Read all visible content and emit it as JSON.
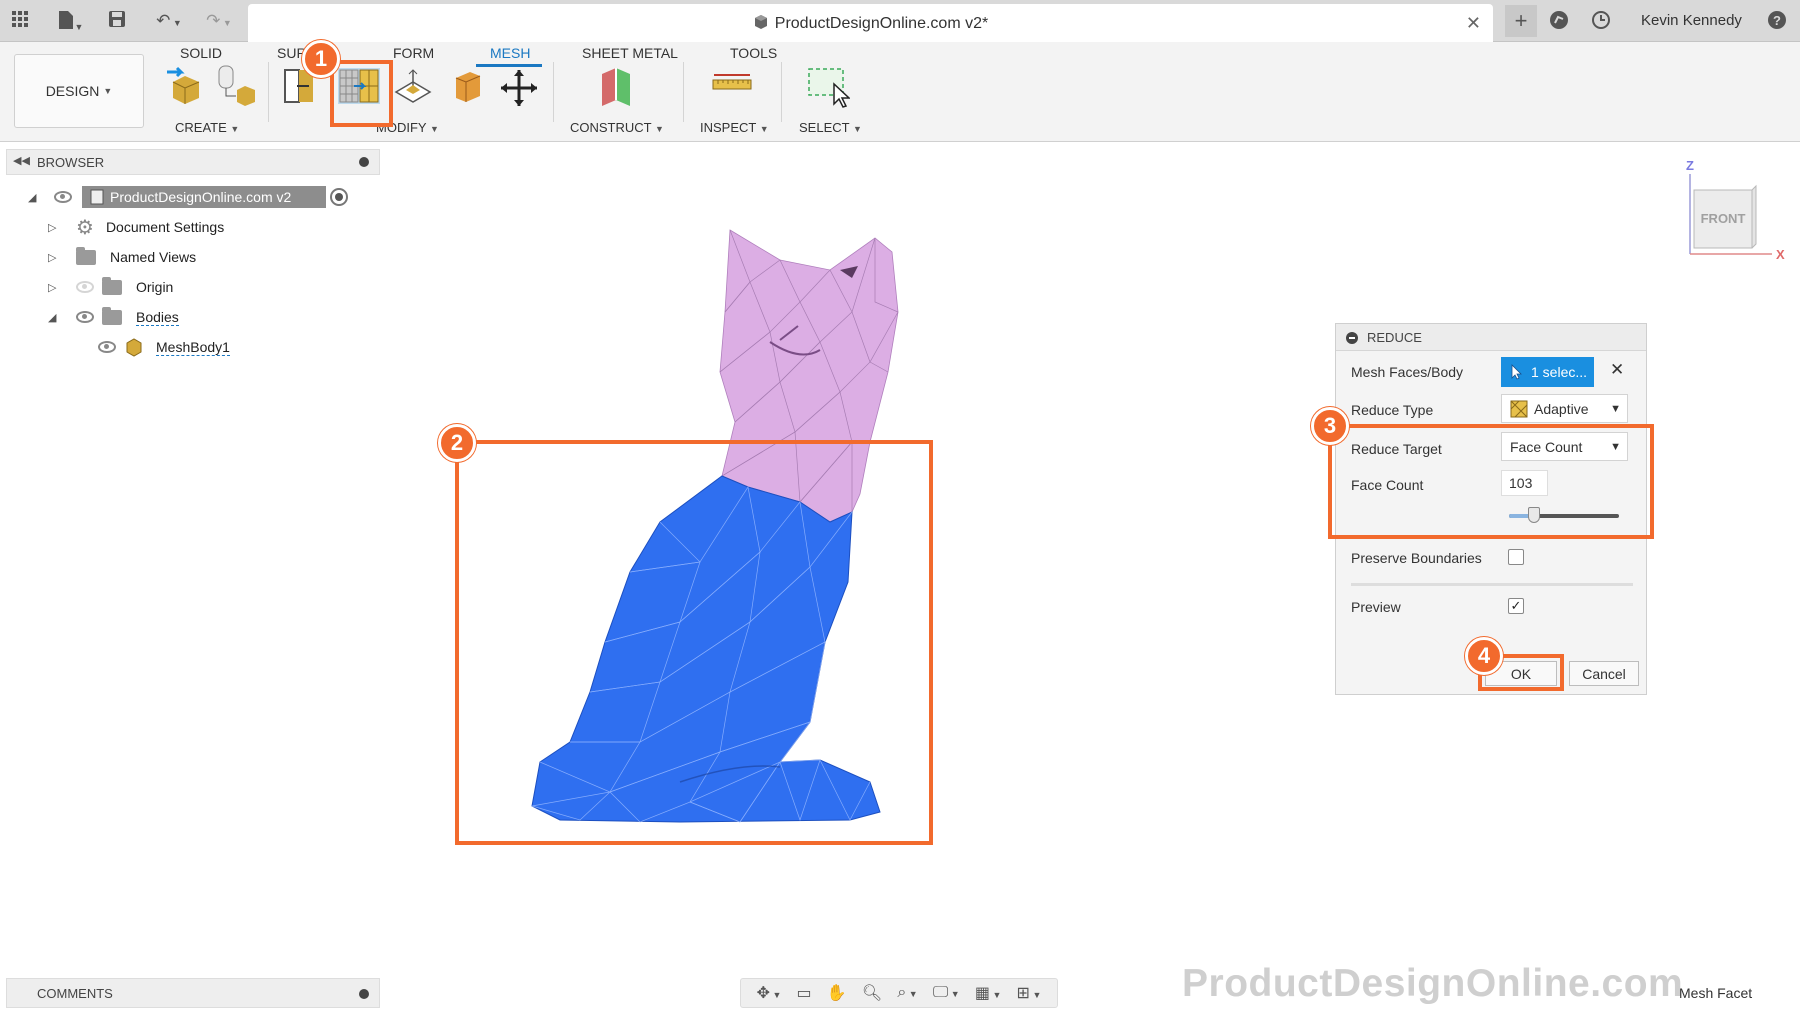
{
  "window": {
    "title": "ProductDesignOnline.com v2*",
    "user_name": "Kevin Kennedy"
  },
  "ribbon": {
    "design_label": "DESIGN",
    "tabs": [
      {
        "label": "SOLID"
      },
      {
        "label": "SUR"
      },
      {
        "label": "FORM"
      },
      {
        "label": "MESH"
      },
      {
        "label": "SHEET METAL"
      },
      {
        "label": "TOOLS"
      }
    ],
    "active_tab": "MESH",
    "groups": {
      "create": "CREATE",
      "modify": "MODIFY",
      "construct": "CONSTRUCT",
      "inspect": "INSPECT",
      "select": "SELECT"
    }
  },
  "browser": {
    "header": "BROWSER",
    "root": "ProductDesignOnline.com v2",
    "items": [
      {
        "label": "Document Settings"
      },
      {
        "label": "Named Views"
      },
      {
        "label": "Origin"
      },
      {
        "label": "Bodies"
      },
      {
        "label": "MeshBody1"
      }
    ]
  },
  "comments": {
    "label": "COMMENTS"
  },
  "viewcube": {
    "face": "FRONT",
    "axis_z": "Z",
    "axis_x": "X"
  },
  "dialog": {
    "title": "REDUCE",
    "mesh_faces_label": "Mesh Faces/Body",
    "selection_value": "1 selec...",
    "reduce_type_label": "Reduce Type",
    "reduce_type_value": "Adaptive",
    "reduce_target_label": "Reduce Target",
    "reduce_target_value": "Face Count",
    "face_count_label": "Face Count",
    "face_count_value": "103",
    "slider_fraction": 0.23,
    "preserve_boundaries_label": "Preserve Boundaries",
    "preserve_boundaries_checked": false,
    "preview_label": "Preview",
    "preview_checked": true,
    "ok_label": "OK",
    "cancel_label": "Cancel"
  },
  "annotations": {
    "step1": "1",
    "step2": "2",
    "step3": "3",
    "step4": "4",
    "color": "#f26a2d"
  },
  "watermark": "ProductDesignOnline.com",
  "status_mode": "Mesh Facet",
  "colors": {
    "accent": "#1a78c2",
    "selected_button": "#1a8fe0",
    "mesh_selected": "#2f6ff0",
    "mesh_unselected": "#d9a8e0"
  }
}
